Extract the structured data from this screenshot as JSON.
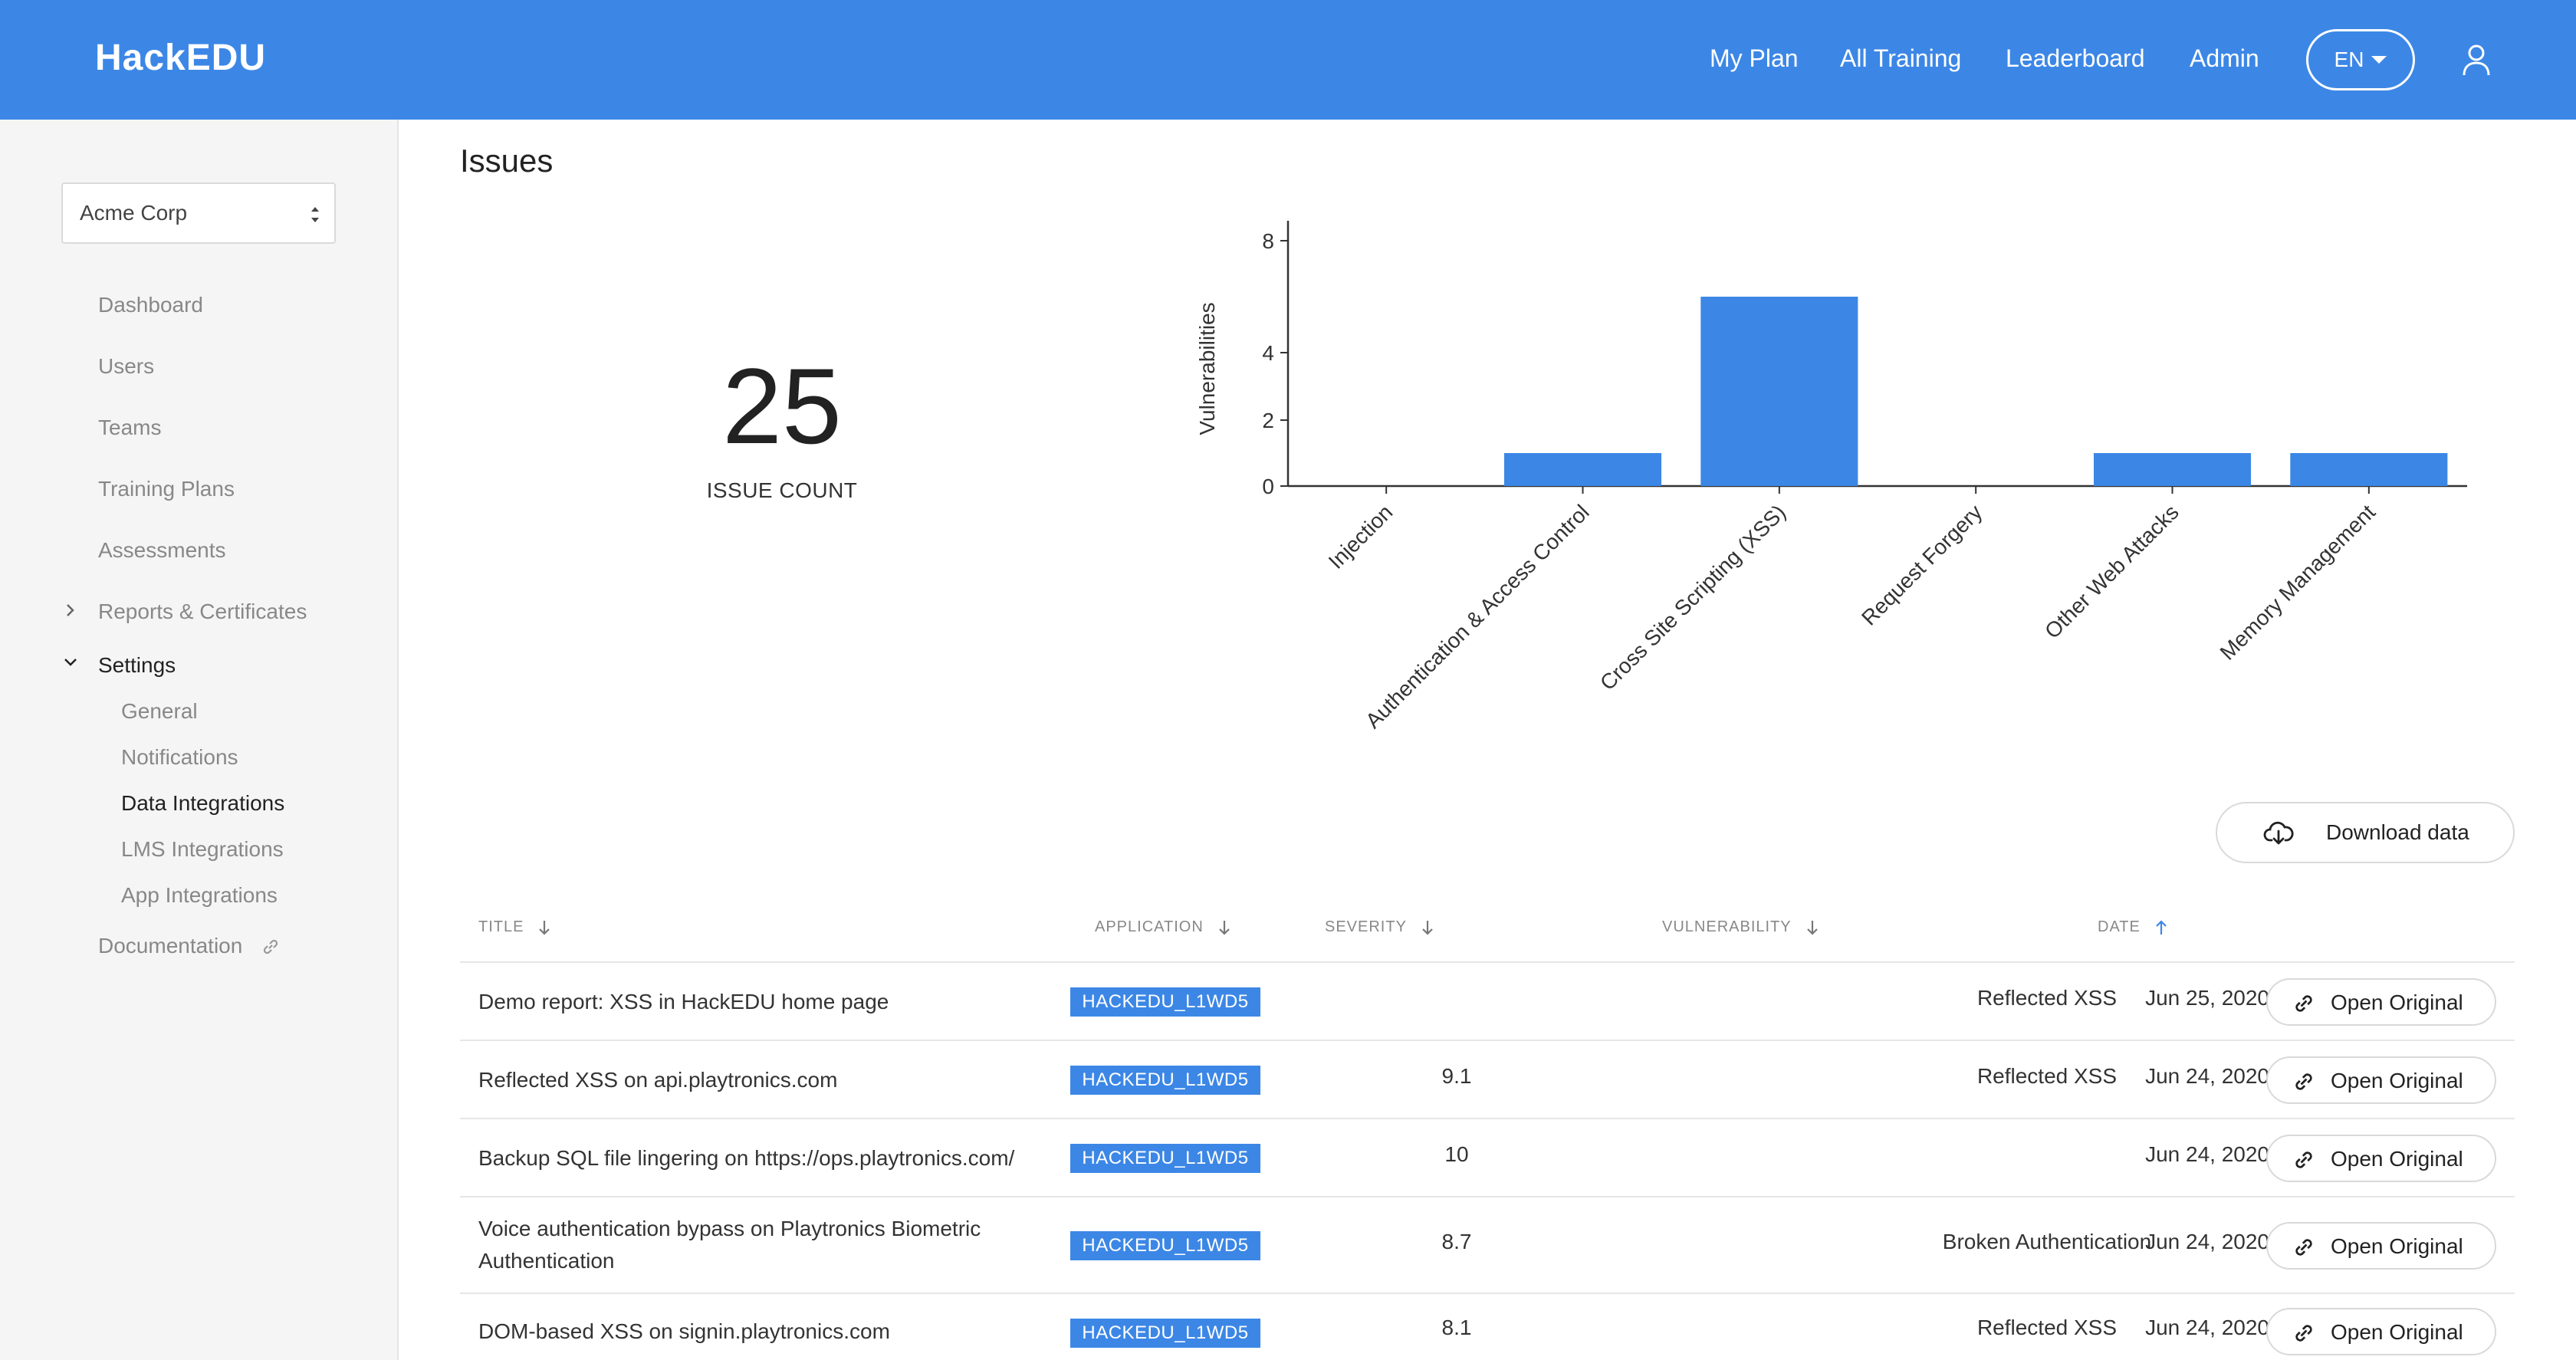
{
  "header": {
    "logo": "HackEDU",
    "nav": [
      "My Plan",
      "All Training",
      "Leaderboard",
      "Admin"
    ],
    "language": "EN"
  },
  "sidebar": {
    "org_select": "Acme Corp",
    "items": [
      "Dashboard",
      "Users",
      "Teams",
      "Training Plans",
      "Assessments",
      "Reports & Certificates"
    ],
    "settings": {
      "label": "Settings",
      "children": [
        "General",
        "Notifications",
        "Data Integrations",
        "LMS Integrations",
        "App Integrations"
      ]
    },
    "documentation": "Documentation"
  },
  "main": {
    "title": "Issues",
    "issue_count": "25",
    "issue_count_label": "ISSUE COUNT",
    "download_label": "Download data"
  },
  "chart_data": {
    "type": "bar",
    "ylabel": "Vulnerabilities",
    "xlabel": "",
    "y_ticks": [
      0,
      2,
      4,
      8
    ],
    "ylim": [
      0,
      8
    ],
    "categories": [
      "Injection",
      "Authentication & Access Control",
      "Cross Site Scripting (XSS)",
      "Request Forgery",
      "Other Web Attacks",
      "Memory Management"
    ],
    "values": [
      0,
      1,
      6,
      0,
      1,
      1
    ],
    "color": "#3c87e6"
  },
  "table": {
    "columns": [
      "TITLE",
      "APPLICATION",
      "SEVERITY",
      "VULNERABILITY",
      "DATE"
    ],
    "action_label": "Open Original",
    "rows": [
      {
        "title": "Demo report: XSS in HackEDU home page",
        "application": "HACKEDU_L1WD5",
        "severity": "",
        "vulnerability": "Reflected XSS",
        "date": "Jun 25, 2020"
      },
      {
        "title": "Reflected XSS on api.playtronics.com",
        "application": "HACKEDU_L1WD5",
        "severity": "9.1",
        "vulnerability": "Reflected XSS",
        "date": "Jun 24, 2020"
      },
      {
        "title": "Backup SQL file lingering on https://ops.playtronics.com/",
        "application": "HACKEDU_L1WD5",
        "severity": "10",
        "vulnerability": "",
        "date": "Jun 24, 2020"
      },
      {
        "title": "Voice authentication bypass on Playtronics Biometric Authentication",
        "application": "HACKEDU_L1WD5",
        "severity": "8.7",
        "vulnerability": "Broken Authentication",
        "date": "Jun 24, 2020"
      },
      {
        "title": "DOM-based XSS on signin.playtronics.com",
        "application": "HACKEDU_L1WD5",
        "severity": "8.1",
        "vulnerability": "Reflected XSS",
        "date": "Jun 24, 2020"
      }
    ]
  }
}
